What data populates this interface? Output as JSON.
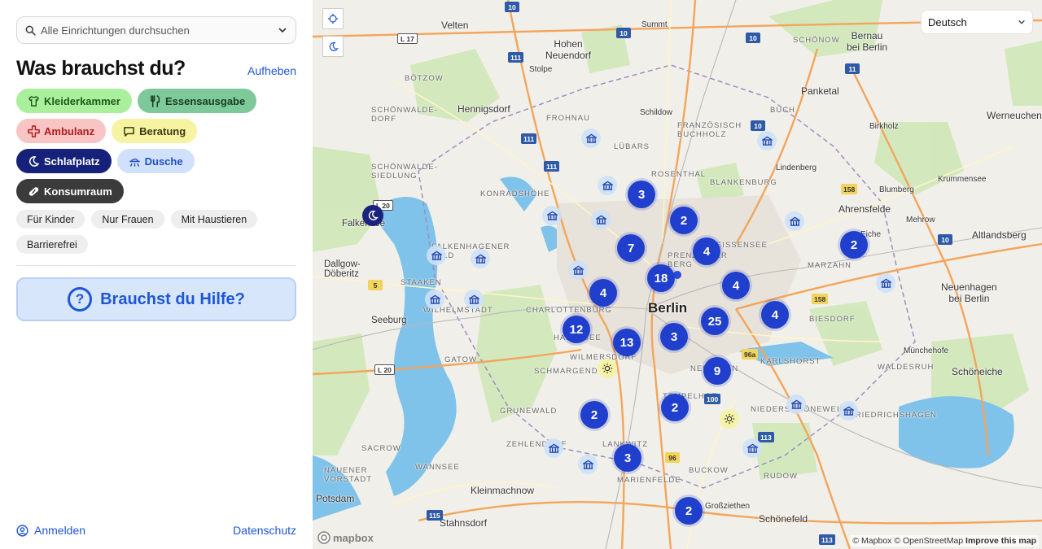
{
  "search": {
    "placeholder": "Alle Einrichtungen durchsuchen"
  },
  "heading": "Was brauchst du?",
  "reset_label": "Aufheben",
  "categories": [
    {
      "label": "Kleiderkammer",
      "icon": "shirt-icon",
      "bg": "#a9ef9c",
      "fg": "#1f5a17"
    },
    {
      "label": "Essensausgabe",
      "icon": "fork-knife-icon",
      "bg": "#7ec99a",
      "fg": "#153d20"
    },
    {
      "label": "Ambulanz",
      "icon": "medical-cross-icon",
      "bg": "#f8c4c4",
      "fg": "#b21c1c"
    },
    {
      "label": "Beratung",
      "icon": "speech-bubble-icon",
      "bg": "#f6f3a3",
      "fg": "#3b3a10"
    },
    {
      "label": "Schlafplatz",
      "icon": "moon-icon",
      "bg": "#16227a",
      "fg": "#ffffff"
    },
    {
      "label": "Dusche",
      "icon": "shower-icon",
      "bg": "#d1e1fb",
      "fg": "#1e4fc2"
    },
    {
      "label": "Konsumraum",
      "icon": "pill-icon",
      "bg": "#3b3b3b",
      "fg": "#ffffff"
    }
  ],
  "filters": [
    "Für Kinder",
    "Nur Frauen",
    "Mit Haustieren",
    "Barrierefrei"
  ],
  "help_label": "Brauchst du Hilfe?",
  "footer": {
    "login": "Anmelden",
    "privacy": "Datenschutz"
  },
  "map": {
    "language": "Deutsch",
    "attribution": {
      "mapbox": "© Mapbox",
      "osm": "© OpenStreetMap",
      "improve": "Improve this map"
    },
    "logo": "mapbox",
    "clusters": [
      "3",
      "2",
      "7",
      "4",
      "2",
      "18",
      "4",
      "4",
      "4",
      "25",
      "12",
      "13",
      "3",
      "9",
      "2",
      "2",
      "3",
      "2"
    ],
    "labels": {
      "berlin": "Berlin",
      "velten": "Velten",
      "hohen_neuendorf": "Hohen\nNeuendorf",
      "hennigsdorf": "Hennigsdorf",
      "bernau": "Bernau\nbei Berlin",
      "panketal": "Panketal",
      "werneuchen": "Werneuchen",
      "ahrensfelde": "Ahrensfelde",
      "altlandsberg": "Altlandsberg",
      "neuenhagen": "Neuenhagen\nbei Berlin",
      "schoeneiche": "Schöneiche",
      "kleinmachnow": "Kleinmachnow",
      "stahnsdorf": "Stahnsdorf",
      "potsdam": "Potsdam",
      "schoenefeld": "Schönefeld",
      "seeburg": "Seeburg",
      "dallgow": "Dallgow-\nDöberitz",
      "falkensee": "Falkensee",
      "stolpe": "Stolpe",
      "schildow": "Schildow",
      "muehlenbeck": "Mühlenbeck",
      "summt": "Summt",
      "birkholz": "Birkholz",
      "bluemberg": "Blumberg",
      "eiche": "Eiche",
      "muenchehofe": "Münchehofe",
      "grossziethen": "Großziethen",
      "mehrow": "Mehrow",
      "lindenberg": "Lindenberg",
      "krummensee": "Krummensee",
      "berlin_districts": [
        "BÖTZOW",
        "FROHNAU",
        "LÜBARS",
        "ROSENTHAL",
        "FRANZÖSISCH\nBUCHHOLZ",
        "BLANKENBURG",
        "SCHÖNWALDE-\nDORF",
        "SCHÖNWALDE-\nSIEDLUNG",
        "KONRADSHÖHE",
        "FALKENHAGENER\nFELD",
        "STAAKEN",
        "CHARLOTTENBURG",
        "WILHELMSTADT",
        "HALENSEE",
        "WILMERSDORF",
        "SCHMARGENDORF",
        "GATOW",
        "TEMPELHOF",
        "ZEHLENDORF",
        "LANKWITZ",
        "MARIENFELDE",
        "BUCKOW",
        "RUDOW",
        "NEUKÖLLN",
        "NIEDERSCHÖNEWEIDE",
        "KARLSHORST",
        "BIESDORF",
        "MARZAHN",
        "WEISSENSEE",
        "PRENZLAUER\nBERG",
        "FRIEDRICHSHAGEN",
        "WALDESRUH",
        "WANNSEE",
        "NAUENER\nVORSTADT",
        "SACROW",
        "GRUNEWALD",
        "BUCH",
        "SCHÖNOW"
      ]
    }
  }
}
